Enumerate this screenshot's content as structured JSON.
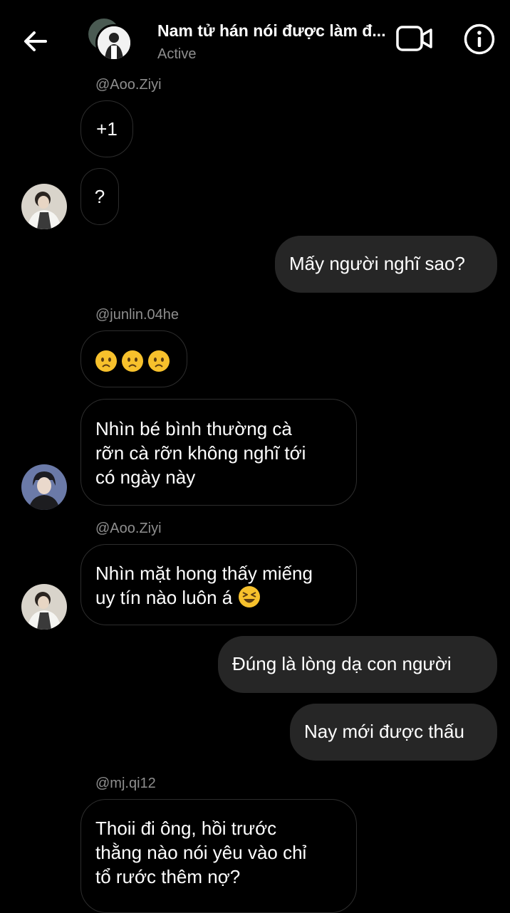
{
  "header": {
    "title": "Nam tử hán nói được làm đ...",
    "status": "Active"
  },
  "messages": [
    {
      "sender": "@Aoo.Ziyi",
      "text": "+1"
    },
    {
      "text": "?"
    },
    {
      "text": "Mấy người nghĩ sao?",
      "outgoing": true
    },
    {
      "sender": "@junlin.04he",
      "text_icons": [
        "worried-face-icon",
        "worried-face-icon",
        "worried-face-icon"
      ]
    },
    {
      "text_lines": [
        "Nhìn bé bình thường cà",
        "rỡn cà rỡn không nghĩ tới",
        "có ngày này"
      ]
    },
    {
      "sender": "@Aoo.Ziyi",
      "text_lines": [
        "Nhìn mặt hong thấy miếng",
        "uy tín nào luôn á"
      ],
      "trailing_icon": "laughing-squint-face-icon"
    },
    {
      "text": "Đúng là lòng dạ con người",
      "outgoing": true
    },
    {
      "text": "Nay mới được thấu",
      "outgoing": true
    },
    {
      "sender": "@mj.qi12",
      "text_lines": [
        "Thoii đi ông, hồi trước",
        "thằng nào nói yêu vào chỉ",
        "tổ rước thêm nợ?"
      ]
    }
  ],
  "colors": {
    "background": "#000000",
    "outgoing_bubble": "#262626",
    "incoming_border": "#2d2d2d",
    "muted_text": "#8e8e8e"
  }
}
